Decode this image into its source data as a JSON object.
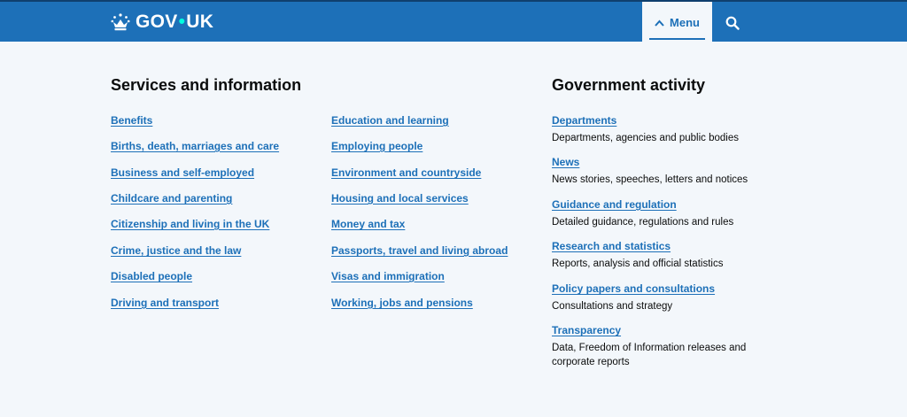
{
  "header": {
    "logo_text_1": "GOV",
    "logo_dot": "•",
    "logo_text_2": "UK",
    "menu_label": "Menu"
  },
  "services": {
    "title": "Services and information",
    "col1": [
      "Benefits",
      "Births, death, marriages and care",
      "Business and self-employed",
      "Childcare and parenting",
      "Citizenship and living in the UK",
      "Crime, justice and the law",
      "Disabled people",
      "Driving and transport"
    ],
    "col2": [
      "Education and learning",
      "Employing people",
      "Environment and countryside",
      "Housing and local services",
      "Money and tax",
      "Passports, travel and living abroad",
      "Visas and immigration",
      "Working, jobs and pensions"
    ]
  },
  "government": {
    "title": "Government activity",
    "items": [
      {
        "label": "Departments",
        "desc": "Departments, agencies and public bodies"
      },
      {
        "label": "News",
        "desc": "News stories, speeches, letters and notices"
      },
      {
        "label": "Guidance and regulation",
        "desc": "Detailed guidance, regulations and rules"
      },
      {
        "label": "Research and statistics",
        "desc": "Reports, analysis and official statistics"
      },
      {
        "label": "Policy papers and consultations",
        "desc": "Consultations and strategy"
      },
      {
        "label": "Transparency",
        "desc": "Data, Freedom of Information releases and corporate reports"
      }
    ]
  },
  "colors": {
    "header_bg": "#1d70b8",
    "link": "#1d70b8",
    "panel_bg": "#f3f7fb",
    "logo_dot": "#00ffe0"
  }
}
